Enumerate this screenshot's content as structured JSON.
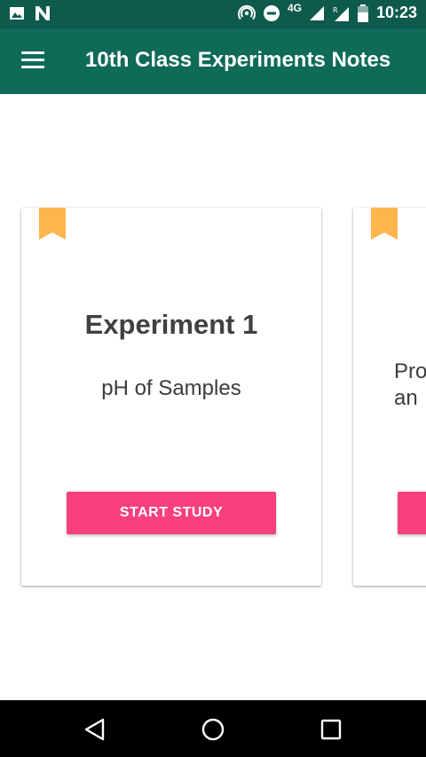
{
  "status_bar": {
    "time": "10:23",
    "network": "4G",
    "icons": [
      "image-icon",
      "n-notification-icon",
      "hotspot-icon",
      "do-not-disturb-icon",
      "signal-icon",
      "roaming-signal-icon",
      "battery-icon"
    ]
  },
  "app_bar": {
    "title": "10th Class Experiments Notes",
    "menu_icon": "hamburger-menu-icon"
  },
  "cards": [
    {
      "title": "Experiment 1",
      "subtitle": "pH of Samples",
      "button_label": "START STUDY",
      "bookmark_icon": "bookmark-icon"
    },
    {
      "subtitle_peek": "Pro\nan",
      "bookmark_icon": "bookmark-icon"
    }
  ],
  "nav_bar": {
    "icons": [
      "back-icon",
      "home-icon",
      "recents-icon"
    ]
  },
  "colors": {
    "status_bar": "#0e5a4c",
    "app_bar": "#0f6a58",
    "accent_button": "#f8407f",
    "bookmark": "#fdb64e"
  }
}
